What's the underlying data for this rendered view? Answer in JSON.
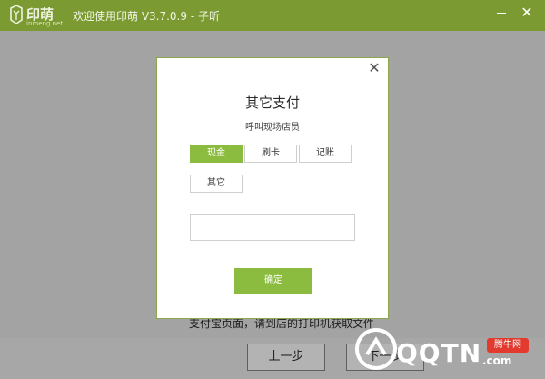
{
  "app": {
    "logo_cn": "印萌",
    "logo_en": "inmeng.net",
    "title": "欢迎使用印萌 V3.7.0.9 - 子昕",
    "minimize_icon": "minimize-icon",
    "close_icon": "close-icon"
  },
  "background": {
    "hint": "支付宝页面，请到店的打印机获取文件",
    "prev_label": "上一步",
    "next_label": "下一步"
  },
  "dialog": {
    "title": "其它支付",
    "subtitle": "呼叫现场店员",
    "close_glyph": "✕",
    "options": [
      "现金",
      "刷卡",
      "记账",
      "其它"
    ],
    "selected_option": "现金",
    "amount_value": "",
    "confirm_label": "确定"
  },
  "watermark": {
    "logo_text": "QQTN",
    "logo_suffix": ".com",
    "badge": "腾牛网"
  },
  "colors": {
    "titlebar": "#7b9a32",
    "accent": "#8cbc3f",
    "overlay": "#a3a3a3",
    "badge": "#e23a2e"
  }
}
